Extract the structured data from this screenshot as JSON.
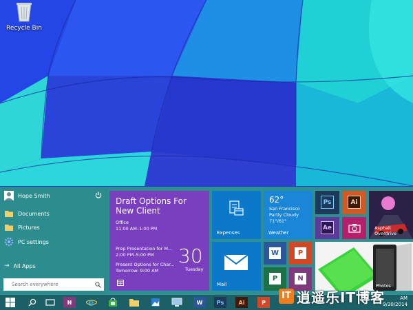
{
  "desktop": {
    "recycle_bin_label": "Recycle Bin"
  },
  "start_menu": {
    "user_name": "Hope Smith",
    "items": [
      {
        "label": "Documents",
        "icon": "folder-icon"
      },
      {
        "label": "Pictures",
        "icon": "folder-icon"
      },
      {
        "label": "PC settings",
        "icon": "gear-icon"
      }
    ],
    "all_apps_label": "All Apps",
    "search_placeholder": "Search everywhere"
  },
  "tiles": {
    "calendar": {
      "title": "Draft Options For New Client",
      "event1_place": "Office",
      "event1_time": "11:00 AM–1:00 PM",
      "event2_title": "Prep Presentation for M...",
      "event2_time": "2:00 PM–5:00 PM",
      "event3_title": "Present Options for Char...",
      "event3_time": "Tomorrow: 9:00 AM",
      "day_number": "30",
      "day_name": "Tuesday"
    },
    "expenses_label": "Expenses",
    "weather": {
      "temp": "62°",
      "city": "San Francisco",
      "condition": "Partly Cloudy",
      "range": "71°/61°",
      "label": "Weather"
    },
    "mail_label": "Mail",
    "ps_label": "Ps",
    "ai_label": "Ai",
    "ae_label": "Ae",
    "asphalt_label": "Asphalt Overdrive",
    "photos_label": "Photos"
  },
  "taskbar": {
    "time": "AM",
    "date": "9/30/2014",
    "ps": "Ps",
    "ai": "Ai",
    "n": "N",
    "w": "W",
    "p": "P"
  },
  "watermark": {
    "logo_text": "IT",
    "text": "逍遥乐IT博客"
  },
  "colors": {
    "start_left": "#2d8c8d",
    "calendar_tile": "#7a3fbf",
    "blue_tile": "#0b78c9",
    "taskbar": "#1c5f66"
  }
}
